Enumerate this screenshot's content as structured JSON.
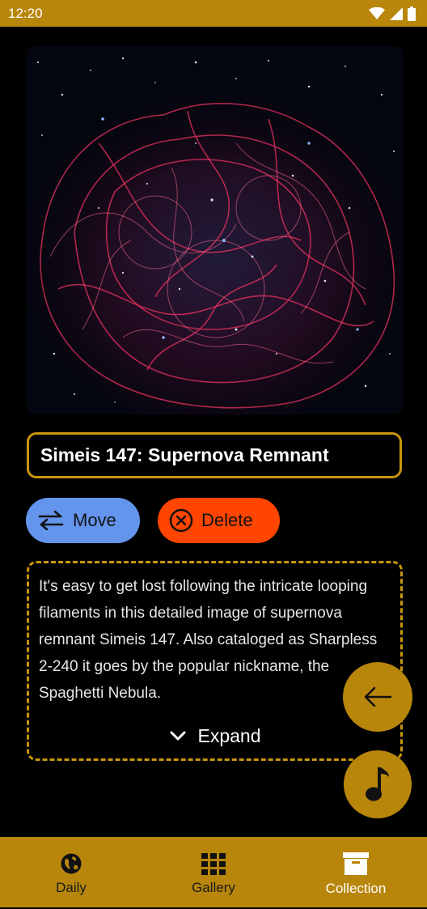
{
  "status_bar": {
    "time": "12:20",
    "icons": [
      "wifi-icon",
      "signal-icon",
      "battery-icon"
    ]
  },
  "image": {
    "subject": "Simeis 147 supernova remnant nebula",
    "icon": "nebula-image"
  },
  "title": {
    "value": "Simeis 147: Supernova Remnant"
  },
  "actions": {
    "move_label": "Move",
    "move_icon": "swap-arrows-icon",
    "delete_label": "Delete",
    "delete_icon": "circle-x-icon"
  },
  "description": {
    "text": "It's easy to get lost following the intricate looping filaments in this detailed image of supernova remnant Simeis 147. Also cataloged as Sharpless 2-240 it goes by the popular nickname, the Spaghetti Nebula.",
    "expand_label": "Expand",
    "expand_icon": "chevron-down-icon"
  },
  "fabs": {
    "back_icon": "arrow-left-icon",
    "music_icon": "music-note-icon"
  },
  "bottom_nav": {
    "items": [
      {
        "label": "Daily",
        "icon": "globe-icon",
        "active": false
      },
      {
        "label": "Gallery",
        "icon": "grid-icon",
        "active": false
      },
      {
        "label": "Collection",
        "icon": "archive-box-icon",
        "active": true
      }
    ]
  },
  "colors": {
    "accent": "#B8860B",
    "border_accent": "#C8960C",
    "move_button": "#6495ED",
    "delete_button": "#FF4500",
    "background": "#000000"
  }
}
